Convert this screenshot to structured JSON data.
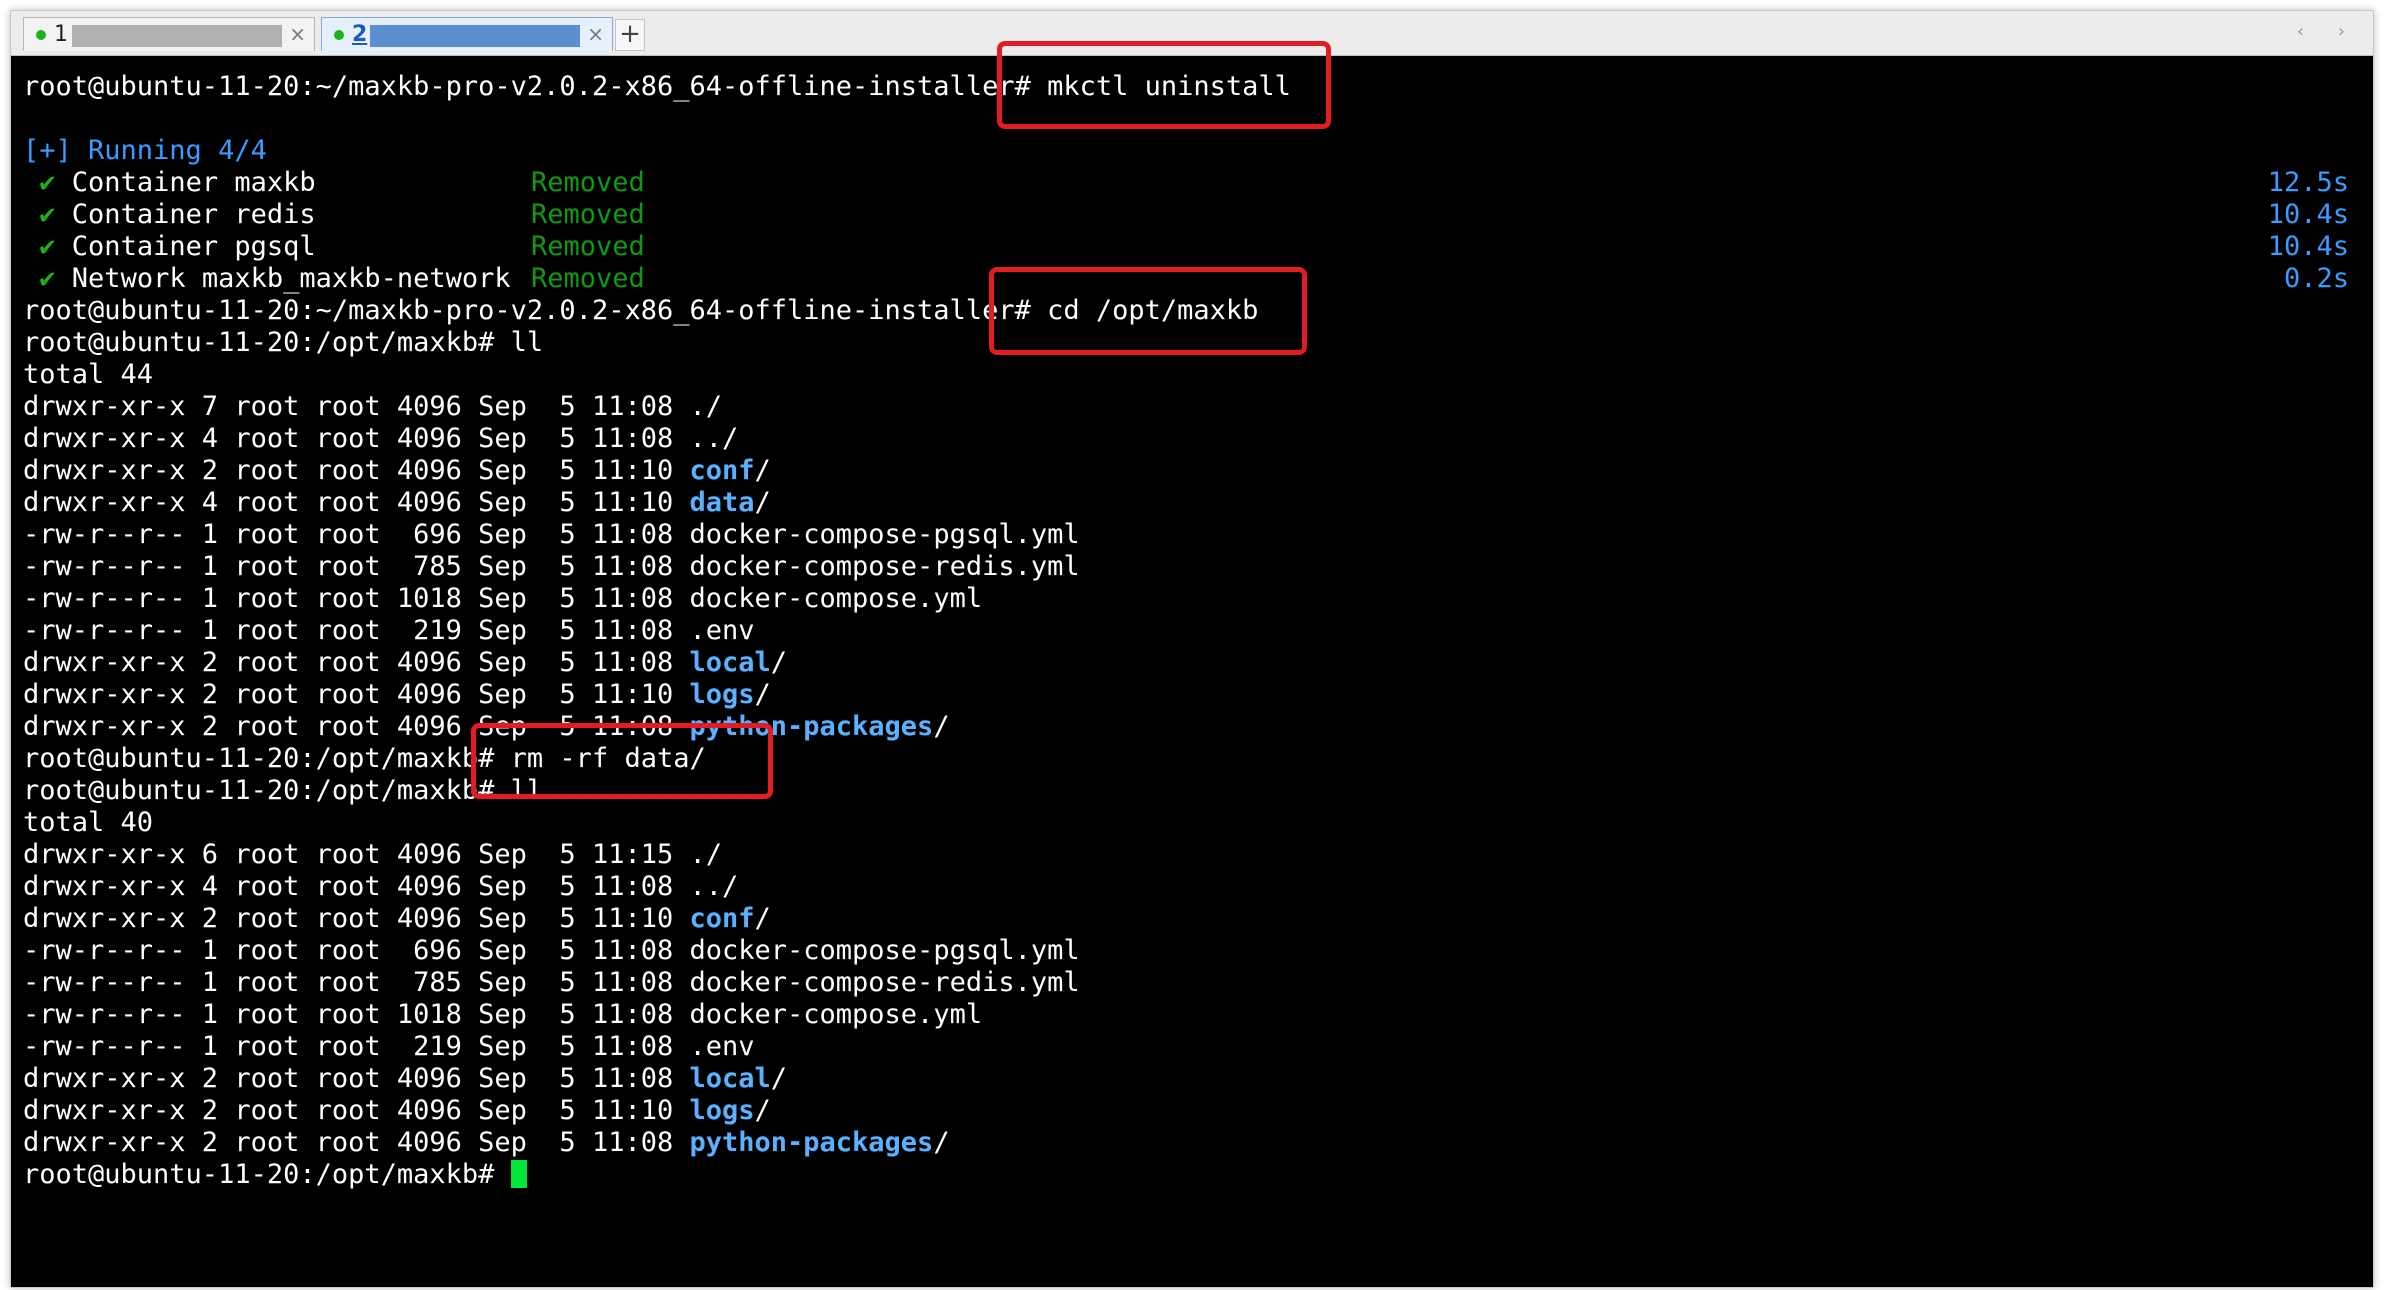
{
  "tabs": [
    {
      "number": "1",
      "active": false,
      "dot_color": "#1db31d"
    },
    {
      "number": "2",
      "active": true,
      "dot_color": "#1db31d"
    }
  ],
  "tab_close": "×",
  "new_tab": "+",
  "scroll_arrows": "‹ ›",
  "terminal": {
    "prompt_installer": "root@ubuntu-11-20:~/maxkb-pro-v2.0.2-x86_64-offline-installer#",
    "prompt_maxkb": "root@ubuntu-11-20:/opt/maxkb#",
    "cmd_uninstall": " mkctl uninstall",
    "running": "[+] Running 4/4",
    "status_removed": "Removed",
    "check": "✔",
    "removals": [
      {
        "name": "Container maxkb",
        "time": "12.5s"
      },
      {
        "name": "Container redis",
        "time": "10.4s"
      },
      {
        "name": "Container pgsql",
        "time": "10.4s"
      },
      {
        "name": "Network maxkb_maxkb-network",
        "time": "0.2s"
      }
    ],
    "cmd_cd": " cd /opt/maxkb",
    "cmd_ll": " ll",
    "cmd_rm": " rm -rf data/",
    "listing1": {
      "total": "total 44",
      "rows": [
        {
          "meta": "drwxr-xr-x 7 root root 4096 Sep  5 11:08 ",
          "name": "./",
          "kind": "plain"
        },
        {
          "meta": "drwxr-xr-x 4 root root 4096 Sep  5 11:08 ",
          "name": "../",
          "kind": "plain"
        },
        {
          "meta": "drwxr-xr-x 2 root root 4096 Sep  5 11:10 ",
          "name": "conf",
          "kind": "dir"
        },
        {
          "meta": "drwxr-xr-x 4 root root 4096 Sep  5 11:10 ",
          "name": "data",
          "kind": "dir"
        },
        {
          "meta": "-rw-r--r-- 1 root root  696 Sep  5 11:08 ",
          "name": "docker-compose-pgsql.yml",
          "kind": "file"
        },
        {
          "meta": "-rw-r--r-- 1 root root  785 Sep  5 11:08 ",
          "name": "docker-compose-redis.yml",
          "kind": "file"
        },
        {
          "meta": "-rw-r--r-- 1 root root 1018 Sep  5 11:08 ",
          "name": "docker-compose.yml",
          "kind": "file"
        },
        {
          "meta": "-rw-r--r-- 1 root root  219 Sep  5 11:08 ",
          "name": ".env",
          "kind": "file"
        },
        {
          "meta": "drwxr-xr-x 2 root root 4096 Sep  5 11:08 ",
          "name": "local",
          "kind": "dir"
        },
        {
          "meta": "drwxr-xr-x 2 root root 4096 Sep  5 11:10 ",
          "name": "logs",
          "kind": "dir"
        },
        {
          "meta": "drwxr-xr-x 2 root root 4096 Sep  5 11:08 ",
          "name": "python-packages",
          "kind": "dir"
        }
      ]
    },
    "listing2": {
      "total": "total 40",
      "rows": [
        {
          "meta": "drwxr-xr-x 6 root root 4096 Sep  5 11:15 ",
          "name": "./",
          "kind": "plain"
        },
        {
          "meta": "drwxr-xr-x 4 root root 4096 Sep  5 11:08 ",
          "name": "../",
          "kind": "plain"
        },
        {
          "meta": "drwxr-xr-x 2 root root 4096 Sep  5 11:10 ",
          "name": "conf",
          "kind": "dir"
        },
        {
          "meta": "-rw-r--r-- 1 root root  696 Sep  5 11:08 ",
          "name": "docker-compose-pgsql.yml",
          "kind": "file"
        },
        {
          "meta": "-rw-r--r-- 1 root root  785 Sep  5 11:08 ",
          "name": "docker-compose-redis.yml",
          "kind": "file"
        },
        {
          "meta": "-rw-r--r-- 1 root root 1018 Sep  5 11:08 ",
          "name": "docker-compose.yml",
          "kind": "file"
        },
        {
          "meta": "-rw-r--r-- 1 root root  219 Sep  5 11:08 ",
          "name": ".env",
          "kind": "file"
        },
        {
          "meta": "drwxr-xr-x 2 root root 4096 Sep  5 11:08 ",
          "name": "local",
          "kind": "dir"
        },
        {
          "meta": "drwxr-xr-x 2 root root 4096 Sep  5 11:10 ",
          "name": "logs",
          "kind": "dir"
        },
        {
          "meta": "drwxr-xr-x 2 root root 4096 Sep  5 11:08 ",
          "name": "python-packages",
          "kind": "dir"
        }
      ]
    }
  },
  "colors": {
    "highlight": "#e31b23",
    "directory": "#5bb1ff",
    "running": "#3a9cff",
    "removed": "#0f9a0f",
    "cursor": "#00e63a"
  }
}
